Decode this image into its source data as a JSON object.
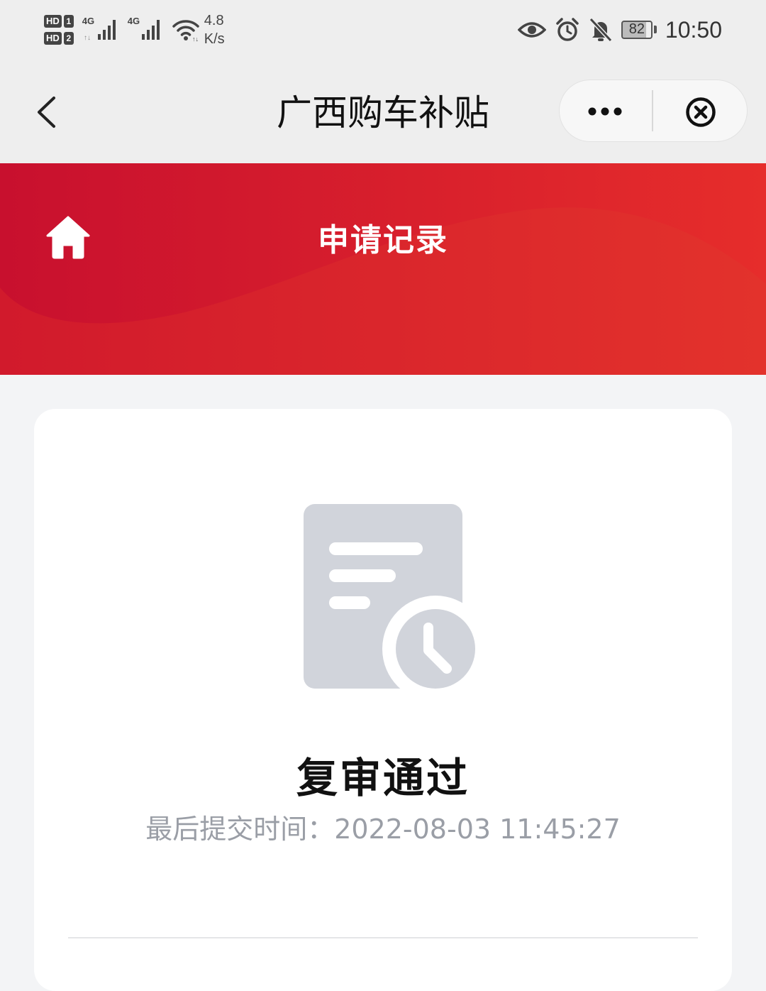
{
  "status_bar": {
    "sim1": {
      "hd": "HD",
      "slot": "1"
    },
    "sim2": {
      "hd": "HD",
      "slot": "2"
    },
    "network1": "4G",
    "network2": "4G",
    "speed_value": "4.8",
    "speed_unit": "K/s",
    "battery": "82",
    "time": "10:50"
  },
  "nav": {
    "title": "广西购车补贴"
  },
  "header": {
    "title": "申请记录"
  },
  "record": {
    "status": "复审通过",
    "submit_label": "最后提交时间：",
    "submit_time": "2022-08-03 11:45:27"
  },
  "colors": {
    "brand_red": "#e62d2b",
    "brand_red_dark": "#c8102e",
    "icon_gray": "#d1d4db",
    "muted_text": "#9a9ea6"
  }
}
